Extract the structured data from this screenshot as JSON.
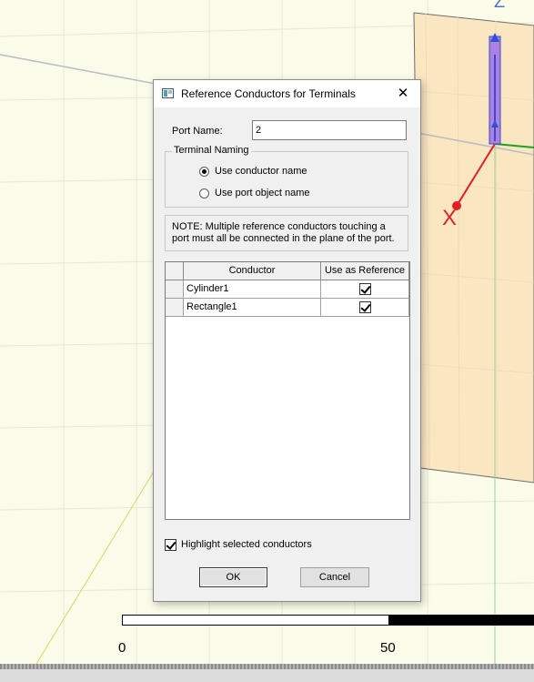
{
  "dialog": {
    "title": "Reference Conductors for Terminals",
    "close_glyph": "✕",
    "port_name_label": "Port Name:",
    "port_name_value": "2",
    "terminal_naming": {
      "legend": "Terminal Naming",
      "options": [
        {
          "label": "Use conductor name",
          "selected": true
        },
        {
          "label": "Use port object name",
          "selected": false
        }
      ]
    },
    "note": "NOTE: Multiple reference conductors touching a port must all be connected in the plane of the port.",
    "table": {
      "columns": [
        "Conductor",
        "Use as Reference"
      ],
      "rows": [
        {
          "conductor": "Cylinder1",
          "use_as_reference": true
        },
        {
          "conductor": "Rectangle1",
          "use_as_reference": true
        }
      ]
    },
    "highlight_label": "Highlight selected conductors",
    "highlight_checked": true,
    "ok_label": "OK",
    "cancel_label": "Cancel"
  },
  "viewport": {
    "scale_labels": [
      "0",
      "50"
    ],
    "axis_labels": {
      "x": "X",
      "z": "Z"
    }
  },
  "colors": {
    "viewport_bg": "#fbfbe9",
    "plane_fill": "#fbe6c2",
    "cylinder": "#b080e0",
    "x_axis": "#e02020",
    "y_axis": "#20a020",
    "z_axis": "#3050d0"
  }
}
